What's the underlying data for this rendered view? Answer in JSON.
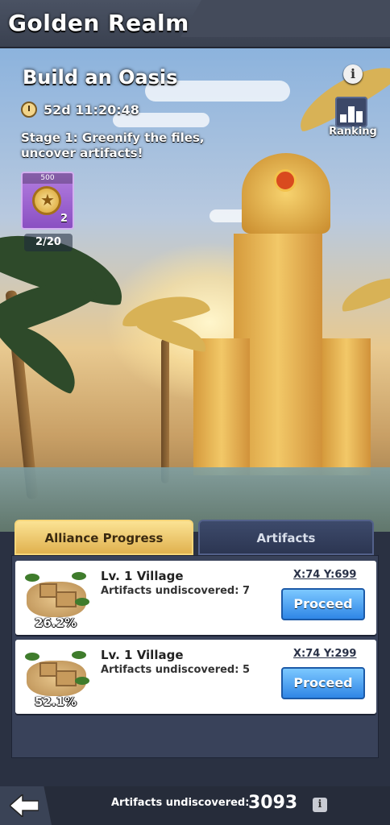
{
  "header": {
    "title": "Golden Realm"
  },
  "event": {
    "title": "Build an Oasis",
    "timer": "52d 11:20:48",
    "stage": "Stage 1: Greenify the files, uncover artifacts!",
    "info_icon": "i",
    "ranking_label": "Ranking"
  },
  "reward": {
    "points": "500",
    "quantity": "2",
    "progress": "2/20",
    "icon": "badge-icon"
  },
  "tabs": [
    {
      "label": "Alliance Progress",
      "active": true
    },
    {
      "label": "Artifacts",
      "active": false
    }
  ],
  "villages": [
    {
      "level": "Lv. 1 Village",
      "undiscovered": "Artifacts undiscovered: 7",
      "coords": "X:74 Y:699",
      "percent": "26.2%",
      "action": "Proceed"
    },
    {
      "level": "Lv. 1 Village",
      "undiscovered": "Artifacts undiscovered: 5",
      "coords": "X:74 Y:299",
      "percent": "52.1%",
      "action": "Proceed"
    }
  ],
  "footer": {
    "label": "Artifacts undiscovered:",
    "count": "3093",
    "info_icon": "i"
  },
  "colors": {
    "accent_gold": "#e0b14f",
    "button_blue": "#2f86e6",
    "panel": "#39425a"
  }
}
